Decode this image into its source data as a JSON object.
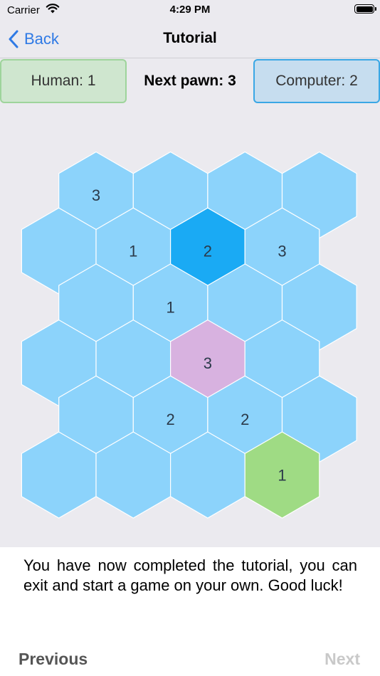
{
  "status_bar": {
    "carrier": "Carrier",
    "time": "4:29 PM",
    "wifi_icon": "wifi-icon",
    "battery_icon": "battery-icon"
  },
  "nav": {
    "back_label": "Back",
    "back_icon": "chevron-left-icon",
    "title": "Tutorial"
  },
  "scores": {
    "human": "Human: 1",
    "next_pawn": "Next pawn: 3",
    "computer": "Computer:  2"
  },
  "colors": {
    "empty": "#8cd3fb",
    "human": "#9fdb84",
    "computer": "#1aaaf4",
    "highlight": "#d8b2e0"
  },
  "board": {
    "rows": [
      [
        {
          "v": "3",
          "s": "empty"
        },
        {
          "v": "",
          "s": "empty"
        },
        {
          "v": "",
          "s": "empty"
        },
        {
          "v": "",
          "s": "empty"
        }
      ],
      [
        {
          "v": "",
          "s": "empty"
        },
        {
          "v": "1",
          "s": "empty"
        },
        {
          "v": "2",
          "s": "computer"
        },
        {
          "v": "3",
          "s": "empty"
        }
      ],
      [
        {
          "v": "",
          "s": "empty"
        },
        {
          "v": "1",
          "s": "empty"
        },
        {
          "v": "",
          "s": "empty"
        },
        {
          "v": "",
          "s": "empty"
        }
      ],
      [
        {
          "v": "",
          "s": "empty"
        },
        {
          "v": "",
          "s": "empty"
        },
        {
          "v": "3",
          "s": "highlight"
        },
        {
          "v": "",
          "s": "empty"
        }
      ],
      [
        {
          "v": "",
          "s": "empty"
        },
        {
          "v": "2",
          "s": "empty"
        },
        {
          "v": "2",
          "s": "empty"
        },
        {
          "v": "",
          "s": "empty"
        }
      ],
      [
        {
          "v": "",
          "s": "empty"
        },
        {
          "v": "",
          "s": "empty"
        },
        {
          "v": "",
          "s": "empty"
        },
        {
          "v": "1",
          "s": "human"
        }
      ]
    ]
  },
  "message": "You have now completed the tutorial, you can exit and start a game on your own. Good luck!",
  "footer": {
    "previous_label": "Previous",
    "next_label": "Next"
  }
}
